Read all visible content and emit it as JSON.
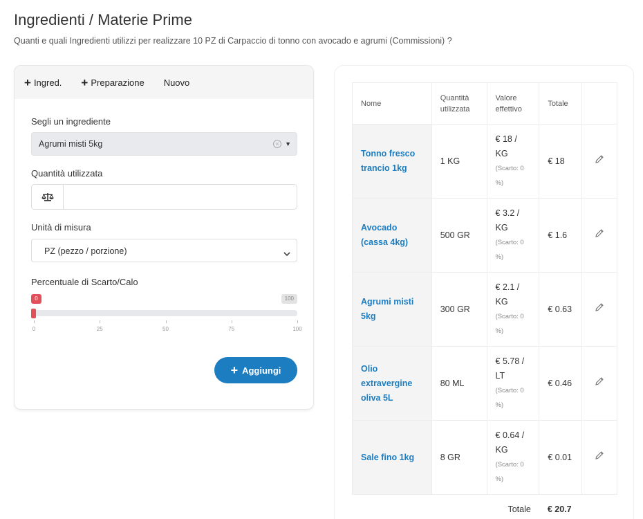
{
  "page": {
    "title": "Ingredienti / Materie Prime",
    "subtitle": "Quanti e quali Ingredienti utilizzi per realizzare 10 PZ di Carpaccio di tonno con avocado e agrumi (Commissioni) ?"
  },
  "toolbar": {
    "add_ingredient": "Ingred.",
    "add_preparation": "Preparazione",
    "new": "Nuovo"
  },
  "form": {
    "ingredient_label": "Segli un ingrediente",
    "ingredient_value": "Agrumi misti 5kg",
    "quantity_label": "Quantità utilizzata",
    "quantity_value": "",
    "unit_label": "Unità di misura",
    "unit_value": "PZ (pezzo / porzione)",
    "waste_label": "Percentuale di Scarto/Calo",
    "waste_value": 0,
    "waste_min_badge": "0",
    "waste_max_badge": "100",
    "ticks": [
      "0",
      "25",
      "50",
      "75",
      "100"
    ],
    "add_button": "Aggiungi",
    "accent_color": "#1c7dc1",
    "slider_color": "#e2515a"
  },
  "table": {
    "headers": {
      "name": "Nome",
      "quantity": "Quantità utilizzata",
      "value": "Valore effettivo",
      "total": "Totale"
    },
    "rows": [
      {
        "name": "Tonno fresco trancio 1kg",
        "qty": "1 KG",
        "value": "€ 18 / KG",
        "scarto": "(Scarto: 0 %)",
        "total": "€ 18"
      },
      {
        "name": "Avocado (cassa 4kg)",
        "qty": "500 GR",
        "value": "€ 3.2 / KG",
        "scarto": "(Scarto: 0 %)",
        "total": "€ 1.6"
      },
      {
        "name": "Agrumi misti 5kg",
        "qty": "300 GR",
        "value": "€ 2.1 / KG",
        "scarto": "(Scarto: 0 %)",
        "total": "€ 0.63"
      },
      {
        "name": "Olio extravergine oliva 5L",
        "qty": "80 ML",
        "value": "€ 5.78 / LT",
        "scarto": "(Scarto: 0 %)",
        "total": "€ 0.46"
      },
      {
        "name": "Sale fino 1kg",
        "qty": "8 GR",
        "value": "€ 0.64 / KG",
        "scarto": "(Scarto: 0 %)",
        "total": "€ 0.01"
      }
    ],
    "total_label": "Totale",
    "total_value": "€ 20.7"
  }
}
